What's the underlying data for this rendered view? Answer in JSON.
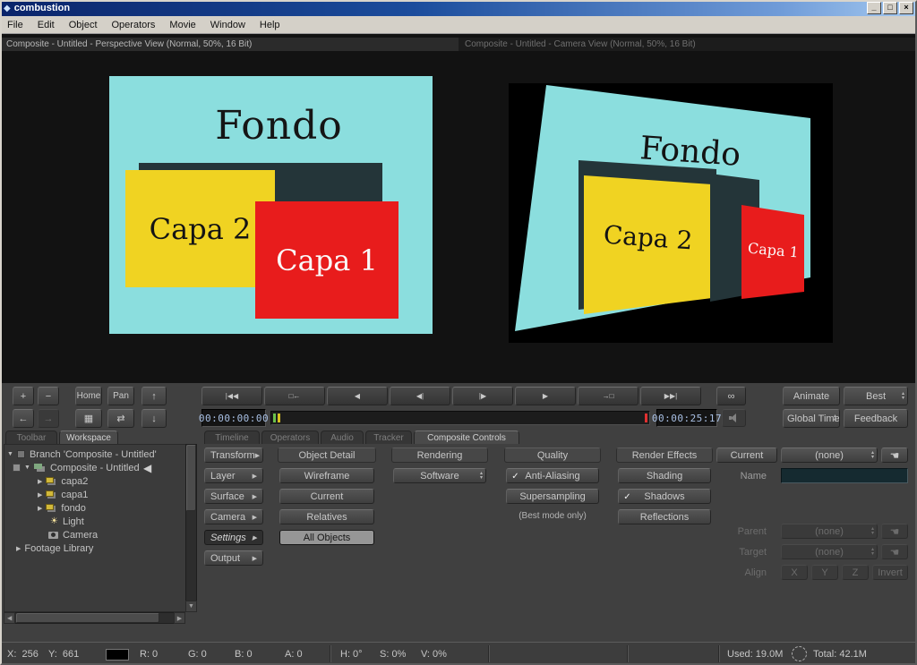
{
  "window": {
    "title": "combustion",
    "controls": {
      "minimize": "_",
      "maximize": "□",
      "close": "×"
    }
  },
  "menubar": {
    "items": [
      "File",
      "Edit",
      "Object",
      "Operators",
      "Movie",
      "Window",
      "Help"
    ]
  },
  "viewports": {
    "left_title": "Composite - Untitled - Perspective View (Normal, 50%, 16 Bit)",
    "right_title": "Composite - Untitled - Camera View (Normal, 50%, 16 Bit)"
  },
  "scene": {
    "background_label": "Fondo",
    "layer2_label": "Capa 2",
    "layer1_label": "Capa 1",
    "colors": {
      "background": "#8BDEDE",
      "layer2": "#F0D322",
      "layer1": "#E81C1C",
      "dark_layer": "#243539",
      "camera_bg": "#000000"
    }
  },
  "nav_toolbar": {
    "zoom_in": "+",
    "zoom_out": "−",
    "home": "Home",
    "pan": "Pan",
    "icons": {
      "up": "↑",
      "back": "←",
      "forward": "→",
      "layout": "▦",
      "swap": "⇄",
      "down": "↓"
    }
  },
  "transport": {
    "go_start": "|◀◀",
    "prev_marker": "□←",
    "play_reverse": "◀",
    "step_back": "◀|",
    "step_forward": "|▶",
    "play": "▶",
    "next_marker": "→□",
    "go_end": "▶▶|",
    "loop": "∞",
    "current_time": "00:00:00:00",
    "end_time": "00:00:25:17"
  },
  "mode_buttons": {
    "animate": "Animate",
    "best": "Best",
    "global_time": "Global Time",
    "feedback": "Feedback"
  },
  "workspace": {
    "tabs": [
      "Toolbar",
      "Workspace"
    ],
    "tree": [
      {
        "label": "Branch 'Composite - Untitled'"
      },
      {
        "label": "Composite - Untitled"
      },
      {
        "label": "capa2"
      },
      {
        "label": "capa1"
      },
      {
        "label": "fondo"
      },
      {
        "label": "Light"
      },
      {
        "label": "Camera"
      },
      {
        "label": "Footage Library"
      }
    ]
  },
  "controls_panel": {
    "tabs": [
      "Timeline",
      "Operators",
      "Audio",
      "Tracker",
      "Composite Controls"
    ],
    "categories": [
      "Transform",
      "Layer",
      "Surface",
      "Camera",
      "Settings",
      "Output"
    ],
    "object_detail": {
      "title": "Object Detail",
      "wireframe": "Wireframe",
      "current": "Current",
      "relatives": "Relatives",
      "all_objects": "All Objects"
    },
    "rendering": {
      "title": "Rendering",
      "mode": "Software"
    },
    "quality": {
      "title": "Quality",
      "anti_aliasing": "Anti-Aliasing",
      "supersampling": "Supersampling",
      "note": "(Best mode only)"
    },
    "render_effects": {
      "title": "Render Effects",
      "shading": "Shading",
      "shadows": "Shadows",
      "reflections": "Reflections"
    },
    "properties": {
      "current_label": "Current",
      "current_value": "(none)",
      "name_label": "Name",
      "name_value": "",
      "parent_label": "Parent",
      "parent_value": "(none)",
      "target_label": "Target",
      "target_value": "(none)",
      "align_label": "Align",
      "x": "X",
      "y": "Y",
      "z": "Z",
      "invert": "Invert"
    }
  },
  "statusbar": {
    "x": "X:  256",
    "y": "Y:  661",
    "r": "R: 0",
    "g": "G: 0",
    "b": "B: 0",
    "a": "A: 0",
    "h": "H: 0°",
    "s": "S: 0%",
    "v": "V: 0%",
    "used": "Used: 19.0M",
    "total": "Total: 42.1M"
  },
  "icons": {
    "check": "✓",
    "spinner_up": "▴",
    "spinner_down": "▾",
    "arrow_right": "▶",
    "arrow_down": "▼",
    "arrow_left_big": "◀",
    "submenu_arrow": "▶",
    "pick": "☚",
    "light": "☀"
  }
}
